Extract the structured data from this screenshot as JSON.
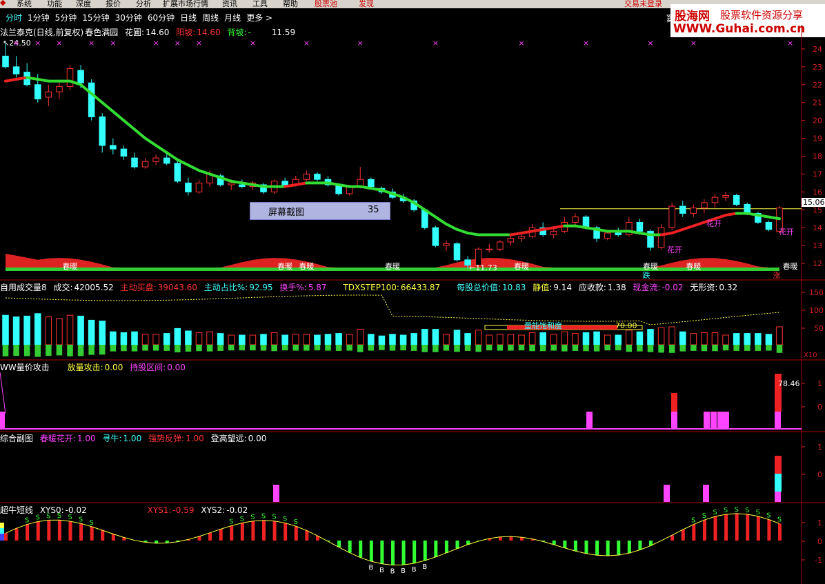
{
  "menu": {
    "items": [
      "系统",
      "功能",
      "深度",
      "报价",
      "分析",
      "扩展市场行情",
      "资讯",
      "工具",
      "帮助"
    ],
    "stock_pool": "股票池",
    "discover": "发现",
    "login_status": "交易未登录",
    "extra": "窦"
  },
  "periods": [
    "分时",
    "1分钟",
    "5分钟",
    "15分钟",
    "30分钟",
    "60分钟",
    "日线",
    "周线",
    "月线",
    "更多 >"
  ],
  "active_period": "分时",
  "main_info": {
    "title": "法兰泰克(日线,前复权)",
    "indicator": "春色满园",
    "flower_label": "花圃:",
    "flower_value": "14.60",
    "sunny_label": "阳坡:",
    "sunny_value": "14.60",
    "shade_label": "背坡:",
    "shade_value": "-",
    "extra_value": "11.59",
    "high_marker": "24.50",
    "low_marker": "11.73"
  },
  "volume_info": {
    "title": "自用成交量8",
    "vol_label": "成交:",
    "vol_value": "42005.52",
    "active_buy_label": "主动买盘:",
    "active_buy_value": "39043.60",
    "ratio_label": "主动占比%:",
    "ratio_value": "92.95",
    "turnover_label": "换手%:",
    "turnover_value": "5.87",
    "step_label": "TDXSTEP100:",
    "step_value": "66433.87",
    "nav_label": "每股总价值:",
    "nav_value": "10.83",
    "static_label": "静值:",
    "static_value": "9.14",
    "recv_label": "应收款:",
    "recv_value": "1.38",
    "cash_label": "现金流:",
    "cash_value": "-0.02",
    "intang_label": "无形资:",
    "intang_value": "0.32",
    "saturation_label": "量能饱和度",
    "saturation_value": "70.00",
    "scale": "X10"
  },
  "attack_info": {
    "title": "WW量价攻击",
    "vol_attack_label": "放量攻击:",
    "vol_attack_value": "0.00",
    "hold_label": "持股区间:",
    "hold_value": "0.00",
    "peak_value": "78.46"
  },
  "combo_info": {
    "title": "综合副图",
    "spring_label": "春暖花开:",
    "spring_value": "1.00",
    "seek_label": "寻牛:",
    "seek_value": "1.00",
    "rebound_label": "强势反弹:",
    "rebound_value": "1.00",
    "climb_label": "登高望远:",
    "climb_value": "0.00"
  },
  "bull_info": {
    "title": "超牛短线",
    "xys0_label": "XYS0:",
    "xys0_value": "-0.02",
    "xys1_label": "XYS1:",
    "xys1_value": "-0.59",
    "xys2_label": "XYS2:",
    "xys2_value": "-0.02"
  },
  "screenshot_box": {
    "label": "屏幕截图",
    "value": "35"
  },
  "price_axis": [
    "24",
    "23",
    "22",
    "21",
    "20",
    "19",
    "18",
    "17",
    "16",
    "15",
    "14",
    "13",
    "12"
  ],
  "current_price_tag": "15.06",
  "vol_axis": [
    "150",
    "100",
    "50"
  ],
  "attack_axis": [
    "1",
    "0"
  ],
  "combo_axis": [
    "1",
    "0"
  ],
  "bull_axis": [
    "1",
    "0",
    "-1"
  ],
  "chart_annotations": {
    "spring": "春暖",
    "bloom": "花开",
    "fall": "跌",
    "rise": "涨",
    "buy": "B",
    "sell": "S"
  },
  "watermark": {
    "line1": "股海网",
    "line2": "股票软件资源分享",
    "line3": "WWW.Guhai.com.cn"
  },
  "chart_data": {
    "type": "candlestick",
    "y_axis_range": [
      11.5,
      24.5
    ],
    "ohlc": [
      [
        23.6,
        24.3,
        22.9,
        23.0
      ],
      [
        23.0,
        23.6,
        22.4,
        22.6
      ],
      [
        22.7,
        23.2,
        21.9,
        22.0
      ],
      [
        22.0,
        22.6,
        21.0,
        21.2
      ],
      [
        21.3,
        22.0,
        20.8,
        21.6
      ],
      [
        21.6,
        22.2,
        21.2,
        21.9
      ],
      [
        21.9,
        23.1,
        21.7,
        22.9
      ],
      [
        22.8,
        23.1,
        21.8,
        22.1
      ],
      [
        22.1,
        22.3,
        20.0,
        20.2
      ],
      [
        20.2,
        20.4,
        18.2,
        18.6
      ],
      [
        18.6,
        19.0,
        18.1,
        18.4
      ],
      [
        18.4,
        18.6,
        17.8,
        18.0
      ],
      [
        17.9,
        18.2,
        17.3,
        17.4
      ],
      [
        17.4,
        17.9,
        17.3,
        17.7
      ],
      [
        17.7,
        18.1,
        17.5,
        17.9
      ],
      [
        17.9,
        18.2,
        17.5,
        17.6
      ],
      [
        17.6,
        17.8,
        16.5,
        16.6
      ],
      [
        16.5,
        16.8,
        15.8,
        16.0
      ],
      [
        16.0,
        16.7,
        15.9,
        16.5
      ],
      [
        16.5,
        17.2,
        16.3,
        17.0
      ],
      [
        16.9,
        17.0,
        16.3,
        16.4
      ],
      [
        16.4,
        16.6,
        16.1,
        16.5
      ],
      [
        16.4,
        16.7,
        16.2,
        16.3
      ],
      [
        16.3,
        16.6,
        16.1,
        16.5
      ],
      [
        16.4,
        16.5,
        15.9,
        16.0
      ],
      [
        16.0,
        16.7,
        15.9,
        16.6
      ],
      [
        16.6,
        16.8,
        16.3,
        16.4
      ],
      [
        16.4,
        16.9,
        16.3,
        16.7
      ],
      [
        16.7,
        17.2,
        16.6,
        17.0
      ],
      [
        17.0,
        17.1,
        16.6,
        16.7
      ],
      [
        16.7,
        16.9,
        16.3,
        16.4
      ],
      [
        16.4,
        16.5,
        15.8,
        15.9
      ],
      [
        15.9,
        16.4,
        15.8,
        16.3
      ],
      [
        16.3,
        17.4,
        16.2,
        16.7
      ],
      [
        16.7,
        16.8,
        16.2,
        16.3
      ],
      [
        16.2,
        16.3,
        15.9,
        16.0
      ],
      [
        16.0,
        16.2,
        15.6,
        15.7
      ],
      [
        15.7,
        15.9,
        15.4,
        15.5
      ],
      [
        15.5,
        15.6,
        14.9,
        15.0
      ],
      [
        15.0,
        15.1,
        13.9,
        14.0
      ],
      [
        14.0,
        14.1,
        12.9,
        13.0
      ],
      [
        13.0,
        13.3,
        12.7,
        13.1
      ],
      [
        13.1,
        13.2,
        12.1,
        12.2
      ],
      [
        12.2,
        12.4,
        11.7,
        11.9
      ],
      [
        11.9,
        12.9,
        11.8,
        12.8
      ],
      [
        12.8,
        13.1,
        12.6,
        12.8
      ],
      [
        12.8,
        13.3,
        12.7,
        13.2
      ],
      [
        13.2,
        13.6,
        13.0,
        13.4
      ],
      [
        13.4,
        13.7,
        13.2,
        13.5
      ],
      [
        13.5,
        14.2,
        13.4,
        14.0
      ],
      [
        14.0,
        14.3,
        13.5,
        13.6
      ],
      [
        13.6,
        14.0,
        13.4,
        13.8
      ],
      [
        13.8,
        14.6,
        13.7,
        14.3
      ],
      [
        14.3,
        14.8,
        14.1,
        14.6
      ],
      [
        14.6,
        14.7,
        13.9,
        14.0
      ],
      [
        14.0,
        14.1,
        13.2,
        13.4
      ],
      [
        13.4,
        13.8,
        13.3,
        13.7
      ],
      [
        13.7,
        14.0,
        13.5,
        13.6
      ],
      [
        13.6,
        14.6,
        13.5,
        14.3
      ],
      [
        14.3,
        14.5,
        13.6,
        13.8
      ],
      [
        13.8,
        13.9,
        12.7,
        12.9
      ],
      [
        12.9,
        14.2,
        12.8,
        14.0
      ],
      [
        14.0,
        15.4,
        13.9,
        15.2
      ],
      [
        15.2,
        15.5,
        14.6,
        14.8
      ],
      [
        14.8,
        15.3,
        14.6,
        15.1
      ],
      [
        15.1,
        15.6,
        14.8,
        15.4
      ],
      [
        15.4,
        15.9,
        15.1,
        15.7
      ],
      [
        15.7,
        16.0,
        15.5,
        15.8
      ],
      [
        15.8,
        15.9,
        15.2,
        15.3
      ],
      [
        15.3,
        15.4,
        14.7,
        14.8
      ],
      [
        14.8,
        14.9,
        14.2,
        14.3
      ],
      [
        14.3,
        14.4,
        13.8,
        13.9
      ],
      [
        13.8,
        15.2,
        13.7,
        15.1
      ]
    ],
    "ma_line": [
      22.2,
      22.3,
      22.4,
      22.3,
      22.2,
      22.2,
      22.2,
      22.0,
      21.5,
      21.0,
      20.5,
      20.0,
      19.5,
      19.0,
      18.6,
      18.2,
      17.8,
      17.5,
      17.2,
      17.0,
      16.8,
      16.6,
      16.5,
      16.4,
      16.3,
      16.3,
      16.3,
      16.4,
      16.5,
      16.5,
      16.5,
      16.4,
      16.3,
      16.3,
      16.2,
      16.1,
      15.9,
      15.7,
      15.4,
      15.0,
      14.6,
      14.2,
      13.9,
      13.7,
      13.6,
      13.6,
      13.6,
      13.6,
      13.7,
      13.8,
      13.9,
      14.0,
      14.1,
      14.1,
      14.0,
      13.9,
      13.8,
      13.8,
      13.8,
      13.7,
      13.6,
      13.6,
      13.7,
      13.9,
      14.1,
      14.3,
      14.5,
      14.7,
      14.8,
      14.8,
      14.7,
      14.6,
      14.5
    ]
  }
}
